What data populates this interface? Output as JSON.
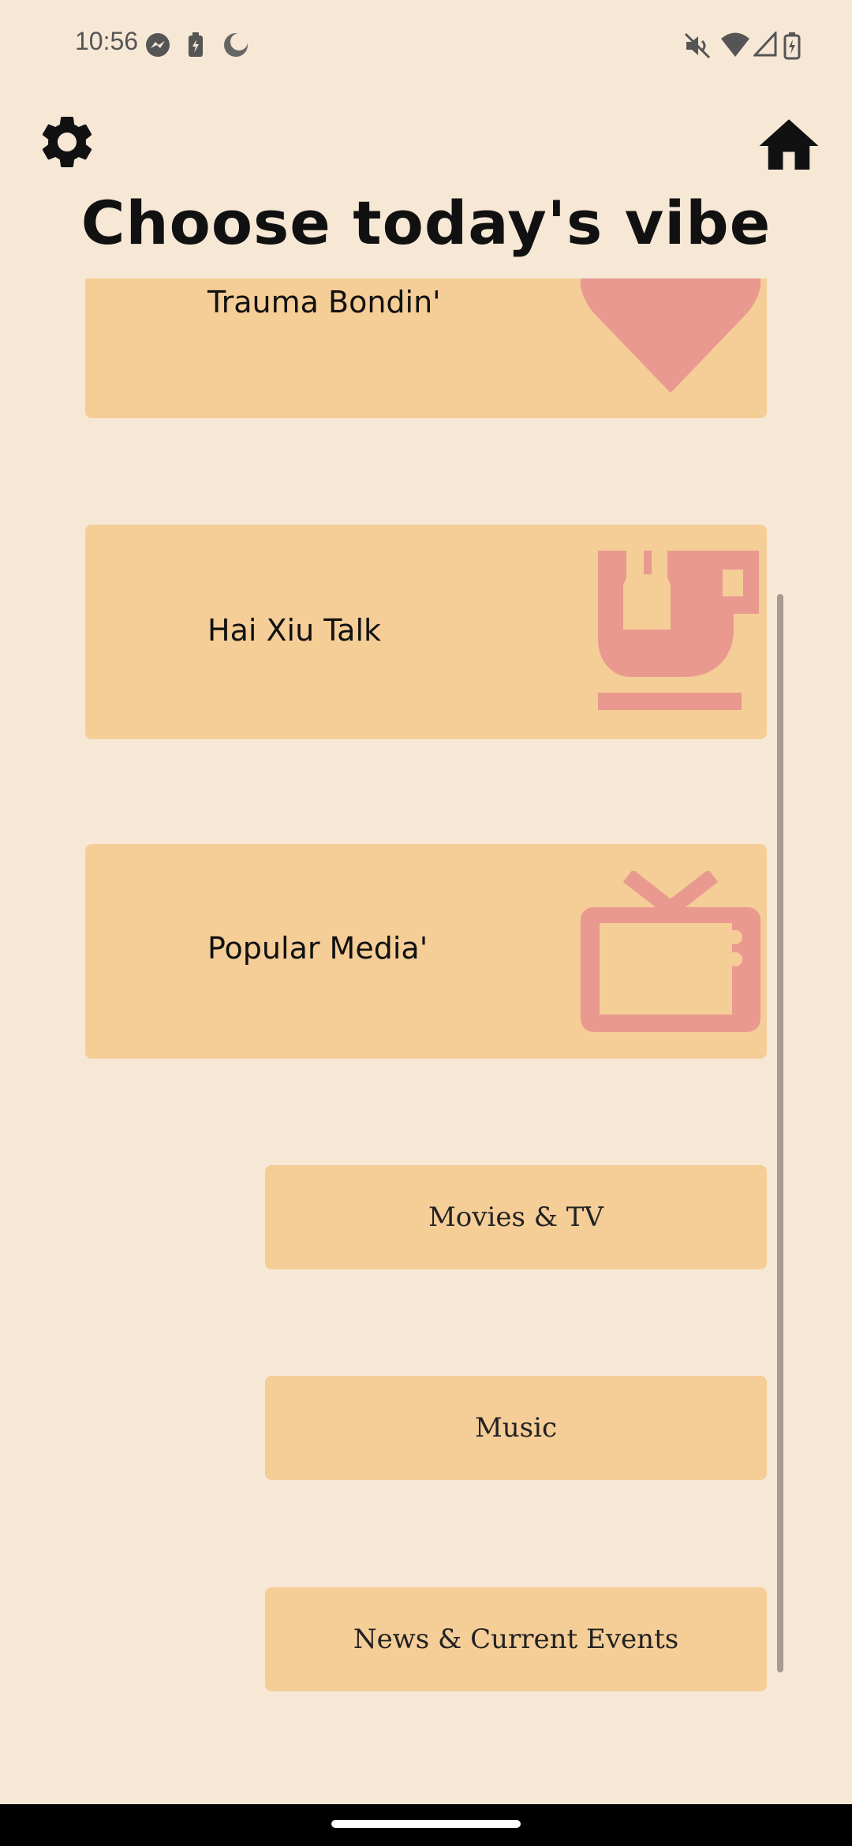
{
  "status": {
    "time": "10:56",
    "left_icons": [
      "messenger-icon",
      "battery-saver-icon",
      "night-mode-icon"
    ],
    "right_icons": [
      "mute-icon",
      "wifi-icon",
      "signal-icon",
      "battery-charging-icon"
    ]
  },
  "header": {
    "settings_icon": "gear-icon",
    "home_icon": "home-icon",
    "title": "Choose today's vibe"
  },
  "cards": [
    {
      "label": "Trauma Bondin'",
      "icon": "heart-icon"
    },
    {
      "label": "Hai Xiu Talk",
      "icon": "tea-cup-icon"
    },
    {
      "label": "Popular Media'",
      "icon": "tv-icon"
    }
  ],
  "sub_options": [
    {
      "label": "Movies & TV"
    },
    {
      "label": "Music"
    },
    {
      "label": "News & Current Events"
    }
  ],
  "colors": {
    "background": "#f7e8d6",
    "card": "#f5cd97",
    "icon_accent": "#e99990",
    "scrollbar": "#a89b92"
  }
}
